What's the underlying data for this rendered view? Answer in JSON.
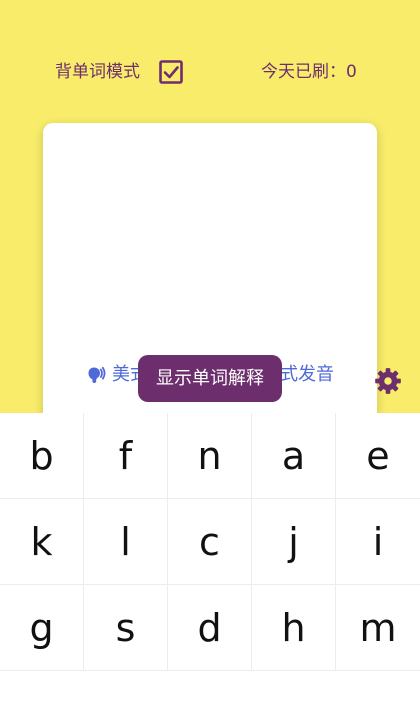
{
  "header": {
    "mode_label": "背单词模式",
    "mode_checked": true,
    "count_label": "今天已刷：0"
  },
  "card": {
    "pron_us_label": "美式发音",
    "pron_uk_label": "英式发音"
  },
  "actions": {
    "show_meaning_label": "显示单词解释"
  },
  "icons": {
    "speaker": "speaker-icon",
    "settings": "gear-icon",
    "checkbox": "checkbox-checked-icon"
  },
  "keyboard": {
    "keys": [
      "b",
      "f",
      "n",
      "a",
      "e",
      "k",
      "l",
      "c",
      "j",
      "i",
      "g",
      "s",
      "d",
      "h",
      "m"
    ]
  },
  "colors": {
    "background": "#f8ec6a",
    "accent": "#6c2e6d",
    "link": "#4e6ad8",
    "card": "#ffffff"
  }
}
